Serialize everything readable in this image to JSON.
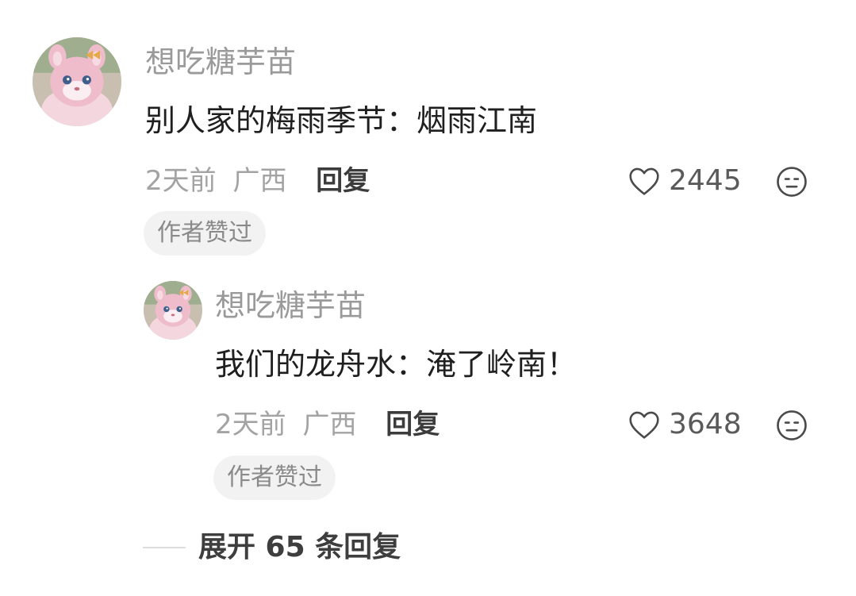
{
  "comments": [
    {
      "username": "想吃糖芋苗",
      "content": "别人家的梅雨季节：烟雨江南",
      "time": "2天前",
      "location": "广西",
      "reply_label": "回复",
      "likes": "2445",
      "badge": "作者赞过"
    },
    {
      "username": "想吃糖芋苗",
      "content": "我们的龙舟水：淹了岭南！",
      "time": "2天前",
      "location": "广西",
      "reply_label": "回复",
      "likes": "3648",
      "badge": "作者赞过"
    }
  ],
  "expand": {
    "label": "展开 65 条回复"
  },
  "icons": {
    "like": "heart-outline-icon",
    "dislike": "unhappy-face-icon",
    "avatar": "pink-bear-plush-avatar"
  },
  "colors": {
    "username": "#9a9a9a",
    "content": "#1f1f1f",
    "meta": "#a3a3a3",
    "reply": "#3c3c3c",
    "badge_bg": "#f2f2f2"
  }
}
